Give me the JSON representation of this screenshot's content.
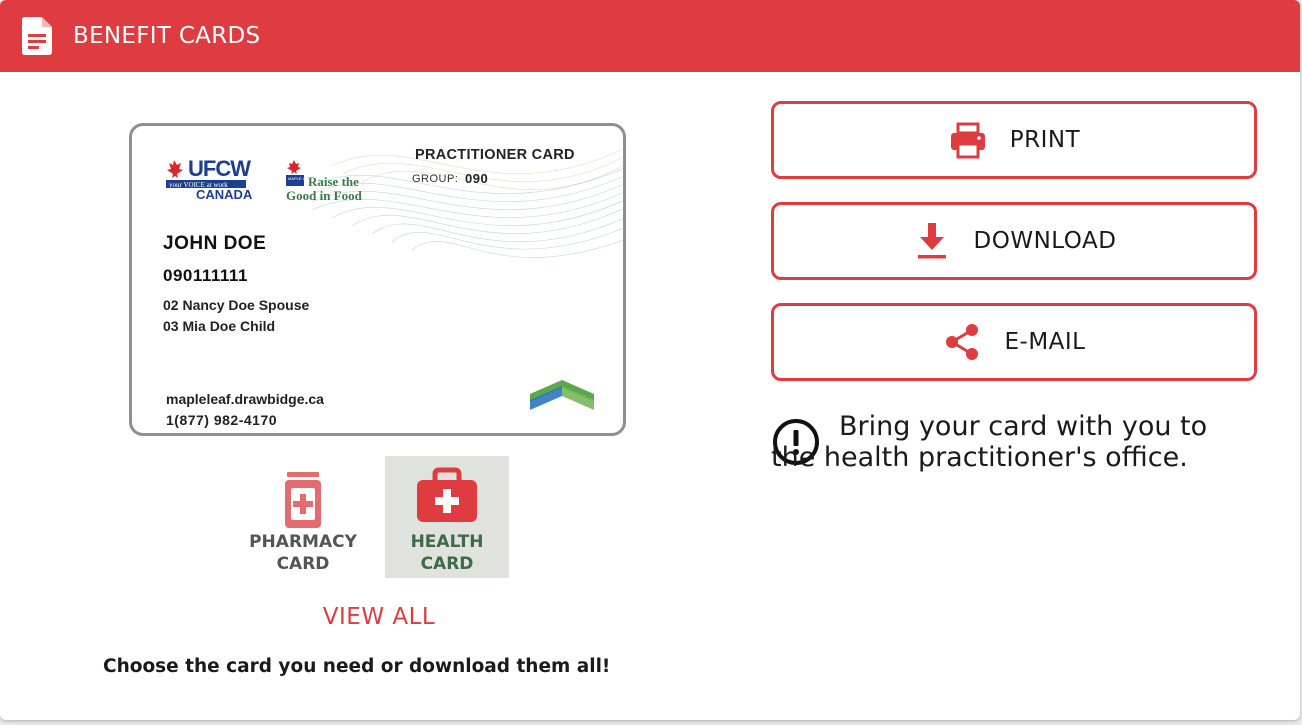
{
  "header": {
    "title": "BENEFIT CARDS",
    "icon": "document-icon",
    "color": "#df3c42"
  },
  "card": {
    "type_label": "PRACTITIONER CARD",
    "group_label": "GROUP:",
    "group_value": "090",
    "member_name": "JOHN DOE",
    "member_id": "090111111",
    "dependents": [
      "02 Nancy Doe Spouse",
      "03 Mia Doe Child"
    ],
    "website": "mapleleaf.drawbidge.ca",
    "phone": "1(877) 982-4170",
    "ufcw_logo": {
      "line1": "UFCW",
      "line2": "your VOICE at work",
      "line3": "CANADA"
    },
    "maple_leaf_logo": {
      "badge": "MAPLE LEAF",
      "line1": "Raise the",
      "line2": "Good in Food"
    }
  },
  "card_selector": {
    "tiles": [
      {
        "label_line1": "PHARMACY",
        "label_line2": "CARD",
        "icon": "pharmacy-bottle-icon",
        "selected": false
      },
      {
        "label_line1": "HEALTH",
        "label_line2": "CARD",
        "icon": "medical-kit-icon",
        "selected": true
      }
    ],
    "view_all": "VIEW ALL",
    "hint": "Choose the card you need or download them all!"
  },
  "actions": {
    "print": {
      "label": "PRINT",
      "icon": "printer-icon"
    },
    "download": {
      "label": "DOWNLOAD",
      "icon": "download-icon"
    },
    "email": {
      "label": "E-MAIL",
      "icon": "share-icon"
    }
  },
  "notice": {
    "text": "Bring your card with you to the health practitioner's office.",
    "icon": "alert-circle-icon"
  },
  "colors": {
    "accent": "#df3c42",
    "selected_bg": "#dfe2dd",
    "selected_text": "#3e6a4a"
  }
}
